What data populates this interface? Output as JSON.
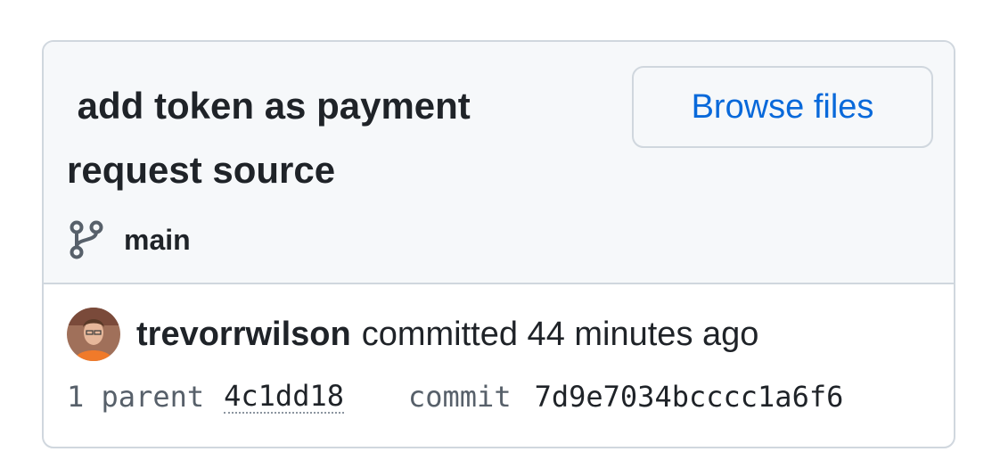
{
  "commit": {
    "title": " add token as payment request source",
    "browse_label": "Browse files",
    "branch": "main",
    "author": "trevorrwilson",
    "action": "committed 44 minutes ago",
    "parent_label": "1 parent",
    "parent_sha": "4c1dd18",
    "commit_label": "commit",
    "commit_sha": "7d9e7034bcccc1a6f6"
  },
  "icons": {
    "branch": "git-branch-icon",
    "avatar": "user-avatar"
  },
  "colors": {
    "link": "#0969da",
    "border": "#d0d7de",
    "header_bg": "#f6f8fa",
    "text": "#1f2328",
    "muted": "#57606a"
  }
}
